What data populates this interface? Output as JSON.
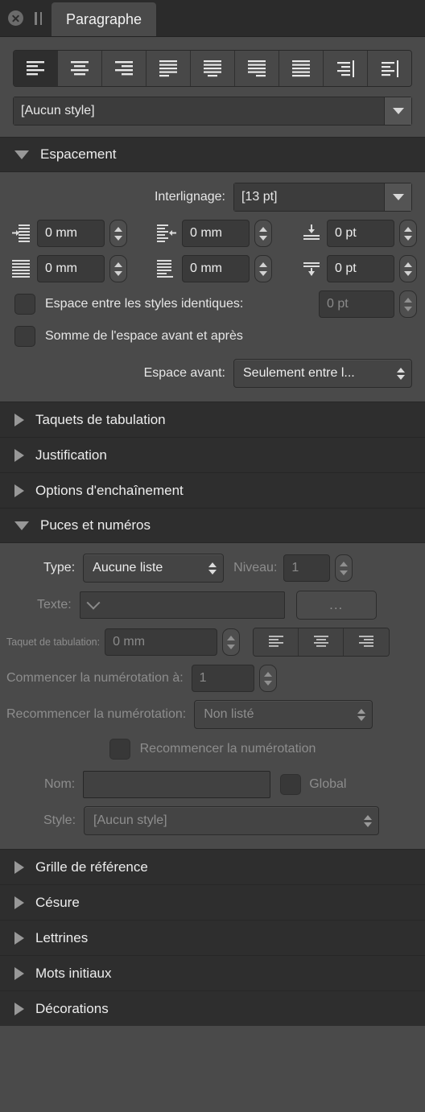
{
  "window": {
    "close_icon": "close-circle-icon",
    "pause_icon": "pause-grip-icon",
    "tab_label": "Paragraphe"
  },
  "alignment": {
    "buttons": [
      {
        "name": "align-left",
        "icon": "align-left-icon",
        "active": true
      },
      {
        "name": "align-center",
        "icon": "align-center-icon",
        "active": false
      },
      {
        "name": "align-right",
        "icon": "align-right-icon",
        "active": false
      },
      {
        "name": "justify-left",
        "icon": "justify-left-icon",
        "active": false
      },
      {
        "name": "justify-center",
        "icon": "justify-center-icon",
        "active": false
      },
      {
        "name": "justify-right",
        "icon": "justify-right-icon",
        "active": false
      },
      {
        "name": "justify-all",
        "icon": "justify-all-icon",
        "active": false
      },
      {
        "name": "align-right-margin",
        "icon": "align-right-margin-icon",
        "active": false
      },
      {
        "name": "align-left-margin",
        "icon": "align-left-margin-icon",
        "active": false
      }
    ]
  },
  "paragraph_style": {
    "value": "[Aucun style]",
    "dropdown_icon": "triangle-down-icon"
  },
  "espacement": {
    "title": "Espacement",
    "twisty": "triangle-down-icon",
    "expanded": true,
    "interlignage": {
      "label": "Interlignage:",
      "value": "[13 pt]",
      "dropdown_icon": "triangle-down-icon"
    },
    "fields": [
      {
        "name": "indent-first-line",
        "icon": "indent-first-line-icon",
        "value": "0 mm",
        "stepper": "stepper-icon"
      },
      {
        "name": "indent-right",
        "icon": "indent-right-icon",
        "value": "0 mm",
        "stepper": "stepper-icon"
      },
      {
        "name": "space-before",
        "icon": "space-before-icon",
        "value": "0 pt",
        "stepper": "stepper-icon"
      },
      {
        "name": "indent-left",
        "icon": "indent-left-icon",
        "value": "0 mm",
        "stepper": "stepper-icon"
      },
      {
        "name": "indent-last-line",
        "icon": "indent-last-line-icon",
        "value": "0 mm",
        "stepper": "stepper-icon"
      },
      {
        "name": "space-after",
        "icon": "space-after-icon",
        "value": "0 pt",
        "stepper": "stepper-icon"
      }
    ],
    "same_style_space": {
      "label": "Espace entre les styles identiques:",
      "checked": false,
      "value": "0 pt"
    },
    "sum_space": {
      "label": "Somme de l'espace avant et après",
      "checked": false
    },
    "space_before_mode": {
      "label": "Espace avant:",
      "value": "Seulement entre l..."
    }
  },
  "sections_middle": [
    {
      "name": "taquets-de-tabulation",
      "label": "Taquets de tabulation",
      "twisty": "triangle-right-icon"
    },
    {
      "name": "justification",
      "label": "Justification",
      "twisty": "triangle-right-icon"
    },
    {
      "name": "options-d-enchainement",
      "label": "Options d'enchaînement",
      "twisty": "triangle-right-icon"
    }
  ],
  "puces": {
    "title": "Puces et numéros",
    "twisty": "triangle-down-icon",
    "expanded": true,
    "type": {
      "label": "Type:",
      "value": "Aucune liste"
    },
    "niveau": {
      "label": "Niveau:",
      "value": "1"
    },
    "texte": {
      "label": "Texte:",
      "value": "",
      "dropdown_icon": "chevron-down-icon",
      "more_button": "..."
    },
    "taquet": {
      "label": "Taquet de tabulation:",
      "value": "0 mm"
    },
    "taquet_align": [
      {
        "name": "bullet-align-left",
        "icon": "align-left-icon"
      },
      {
        "name": "bullet-align-center",
        "icon": "align-center-icon"
      },
      {
        "name": "bullet-align-right",
        "icon": "align-right-icon"
      }
    ],
    "commencer": {
      "label": "Commencer la numérotation à:",
      "value": "1"
    },
    "recommencer_select": {
      "label": "Recommencer la numérotation:",
      "value": "Non listé"
    },
    "recommencer_check": {
      "label": "Recommencer la numérotation",
      "checked": false
    },
    "nom": {
      "label": "Nom:",
      "value": ""
    },
    "global": {
      "label": "Global",
      "checked": false
    },
    "style": {
      "label": "Style:",
      "value": "[Aucun style]"
    }
  },
  "sections_bottom": [
    {
      "name": "grille-de-reference",
      "label": "Grille de référence",
      "twisty": "triangle-right-icon"
    },
    {
      "name": "cesure",
      "label": "Césure",
      "twisty": "triangle-right-icon"
    },
    {
      "name": "lettrines",
      "label": "Lettrines",
      "twisty": "triangle-right-icon"
    },
    {
      "name": "mots-initiaux",
      "label": "Mots initiaux",
      "twisty": "triangle-right-icon"
    },
    {
      "name": "decorations",
      "label": "Décorations",
      "twisty": "triangle-right-icon"
    }
  ],
  "colors": {
    "panel_bg": "#4a4a4a",
    "header_bg": "#2e2e2e",
    "tabbar_bg": "#2b2b2b",
    "text": "#ededed",
    "text_dim": "#8d8d8d"
  }
}
